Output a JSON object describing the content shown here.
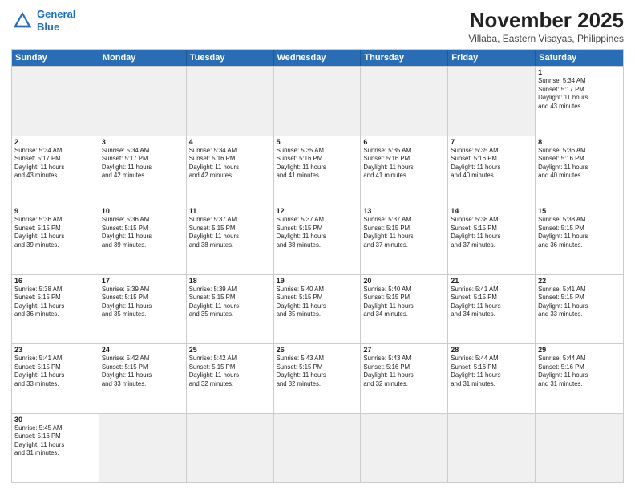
{
  "header": {
    "logo_line1": "General",
    "logo_line2": "Blue",
    "title": "November 2025",
    "subtitle": "Villaba, Eastern Visayas, Philippines"
  },
  "days_of_week": [
    "Sunday",
    "Monday",
    "Tuesday",
    "Wednesday",
    "Thursday",
    "Friday",
    "Saturday"
  ],
  "weeks": [
    [
      {
        "day": "",
        "text": ""
      },
      {
        "day": "",
        "text": ""
      },
      {
        "day": "",
        "text": ""
      },
      {
        "day": "",
        "text": ""
      },
      {
        "day": "",
        "text": ""
      },
      {
        "day": "",
        "text": ""
      },
      {
        "day": "1",
        "text": "Sunrise: 5:34 AM\nSunset: 5:17 PM\nDaylight: 11 hours\nand 43 minutes."
      }
    ],
    [
      {
        "day": "2",
        "text": "Sunrise: 5:34 AM\nSunset: 5:17 PM\nDaylight: 11 hours\nand 43 minutes."
      },
      {
        "day": "3",
        "text": "Sunrise: 5:34 AM\nSunset: 5:17 PM\nDaylight: 11 hours\nand 42 minutes."
      },
      {
        "day": "4",
        "text": "Sunrise: 5:34 AM\nSunset: 5:16 PM\nDaylight: 11 hours\nand 42 minutes."
      },
      {
        "day": "5",
        "text": "Sunrise: 5:35 AM\nSunset: 5:16 PM\nDaylight: 11 hours\nand 41 minutes."
      },
      {
        "day": "6",
        "text": "Sunrise: 5:35 AM\nSunset: 5:16 PM\nDaylight: 11 hours\nand 41 minutes."
      },
      {
        "day": "7",
        "text": "Sunrise: 5:35 AM\nSunset: 5:16 PM\nDaylight: 11 hours\nand 40 minutes."
      },
      {
        "day": "8",
        "text": "Sunrise: 5:36 AM\nSunset: 5:16 PM\nDaylight: 11 hours\nand 40 minutes."
      }
    ],
    [
      {
        "day": "9",
        "text": "Sunrise: 5:36 AM\nSunset: 5:15 PM\nDaylight: 11 hours\nand 39 minutes."
      },
      {
        "day": "10",
        "text": "Sunrise: 5:36 AM\nSunset: 5:15 PM\nDaylight: 11 hours\nand 39 minutes."
      },
      {
        "day": "11",
        "text": "Sunrise: 5:37 AM\nSunset: 5:15 PM\nDaylight: 11 hours\nand 38 minutes."
      },
      {
        "day": "12",
        "text": "Sunrise: 5:37 AM\nSunset: 5:15 PM\nDaylight: 11 hours\nand 38 minutes."
      },
      {
        "day": "13",
        "text": "Sunrise: 5:37 AM\nSunset: 5:15 PM\nDaylight: 11 hours\nand 37 minutes."
      },
      {
        "day": "14",
        "text": "Sunrise: 5:38 AM\nSunset: 5:15 PM\nDaylight: 11 hours\nand 37 minutes."
      },
      {
        "day": "15",
        "text": "Sunrise: 5:38 AM\nSunset: 5:15 PM\nDaylight: 11 hours\nand 36 minutes."
      }
    ],
    [
      {
        "day": "16",
        "text": "Sunrise: 5:38 AM\nSunset: 5:15 PM\nDaylight: 11 hours\nand 36 minutes."
      },
      {
        "day": "17",
        "text": "Sunrise: 5:39 AM\nSunset: 5:15 PM\nDaylight: 11 hours\nand 35 minutes."
      },
      {
        "day": "18",
        "text": "Sunrise: 5:39 AM\nSunset: 5:15 PM\nDaylight: 11 hours\nand 35 minutes."
      },
      {
        "day": "19",
        "text": "Sunrise: 5:40 AM\nSunset: 5:15 PM\nDaylight: 11 hours\nand 35 minutes."
      },
      {
        "day": "20",
        "text": "Sunrise: 5:40 AM\nSunset: 5:15 PM\nDaylight: 11 hours\nand 34 minutes."
      },
      {
        "day": "21",
        "text": "Sunrise: 5:41 AM\nSunset: 5:15 PM\nDaylight: 11 hours\nand 34 minutes."
      },
      {
        "day": "22",
        "text": "Sunrise: 5:41 AM\nSunset: 5:15 PM\nDaylight: 11 hours\nand 33 minutes."
      }
    ],
    [
      {
        "day": "23",
        "text": "Sunrise: 5:41 AM\nSunset: 5:15 PM\nDaylight: 11 hours\nand 33 minutes."
      },
      {
        "day": "24",
        "text": "Sunrise: 5:42 AM\nSunset: 5:15 PM\nDaylight: 11 hours\nand 33 minutes."
      },
      {
        "day": "25",
        "text": "Sunrise: 5:42 AM\nSunset: 5:15 PM\nDaylight: 11 hours\nand 32 minutes."
      },
      {
        "day": "26",
        "text": "Sunrise: 5:43 AM\nSunset: 5:15 PM\nDaylight: 11 hours\nand 32 minutes."
      },
      {
        "day": "27",
        "text": "Sunrise: 5:43 AM\nSunset: 5:16 PM\nDaylight: 11 hours\nand 32 minutes."
      },
      {
        "day": "28",
        "text": "Sunrise: 5:44 AM\nSunset: 5:16 PM\nDaylight: 11 hours\nand 31 minutes."
      },
      {
        "day": "29",
        "text": "Sunrise: 5:44 AM\nSunset: 5:16 PM\nDaylight: 11 hours\nand 31 minutes."
      }
    ],
    [
      {
        "day": "30",
        "text": "Sunrise: 5:45 AM\nSunset: 5:16 PM\nDaylight: 11 hours\nand 31 minutes."
      },
      {
        "day": "",
        "text": ""
      },
      {
        "day": "",
        "text": ""
      },
      {
        "day": "",
        "text": ""
      },
      {
        "day": "",
        "text": ""
      },
      {
        "day": "",
        "text": ""
      },
      {
        "day": "",
        "text": ""
      }
    ]
  ]
}
